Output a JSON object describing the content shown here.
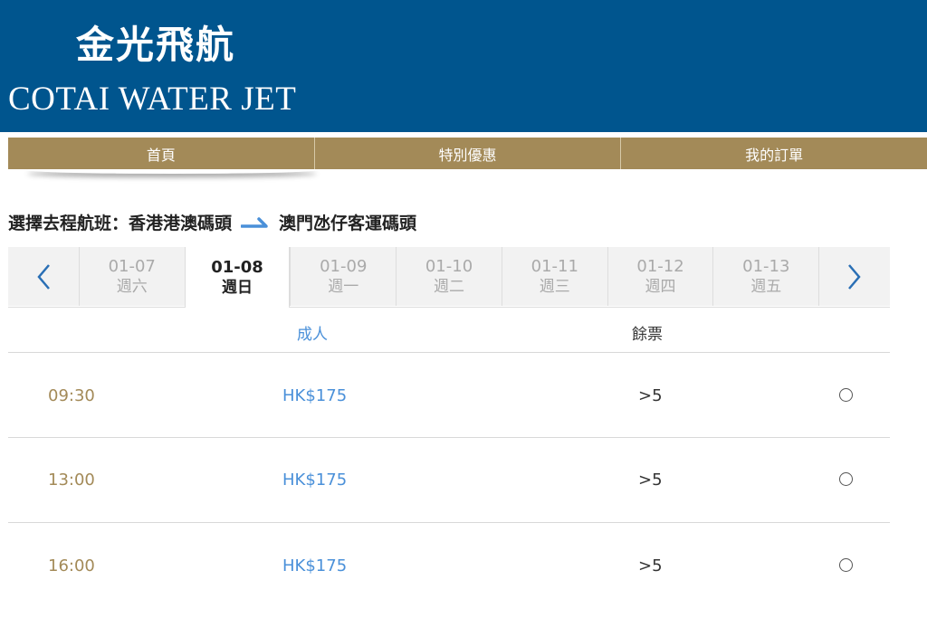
{
  "header": {
    "logo_cn": "金光飛航",
    "logo_en": "COTAI WATER JET",
    "bg_color": "#00558e"
  },
  "nav": {
    "items": [
      "首頁",
      "特別優惠",
      "我的訂單"
    ],
    "bg_color": "#a38a58"
  },
  "route": {
    "prefix": "選擇去程航班：",
    "from": "香港港澳碼頭",
    "to": "澳門氹仔客運碼頭",
    "arrow_icon": "arrow-right-icon",
    "arrow_color": "#4a90d9"
  },
  "date_selector": {
    "prev_icon": "chevron-left-icon",
    "next_icon": "chevron-right-icon",
    "days": [
      {
        "date": "01-07",
        "weekday": "週六"
      },
      {
        "date": "01-08",
        "weekday": "週日"
      },
      {
        "date": "01-09",
        "weekday": "週一"
      },
      {
        "date": "01-10",
        "weekday": "週二"
      },
      {
        "date": "01-11",
        "weekday": "週三"
      },
      {
        "date": "01-12",
        "weekday": "週四"
      },
      {
        "date": "01-13",
        "weekday": "週五"
      }
    ],
    "selected_date": "01-08"
  },
  "table": {
    "headers": {
      "adult": "成人",
      "remaining": "餘票"
    },
    "rows": [
      {
        "time": "09:30",
        "price": "HK$175",
        "tickets": ">5"
      },
      {
        "time": "13:00",
        "price": "HK$175",
        "tickets": ">5"
      },
      {
        "time": "16:00",
        "price": "HK$175",
        "tickets": ">5"
      }
    ]
  },
  "colors": {
    "gold": "#a38a58",
    "link_blue": "#4a90d9"
  }
}
